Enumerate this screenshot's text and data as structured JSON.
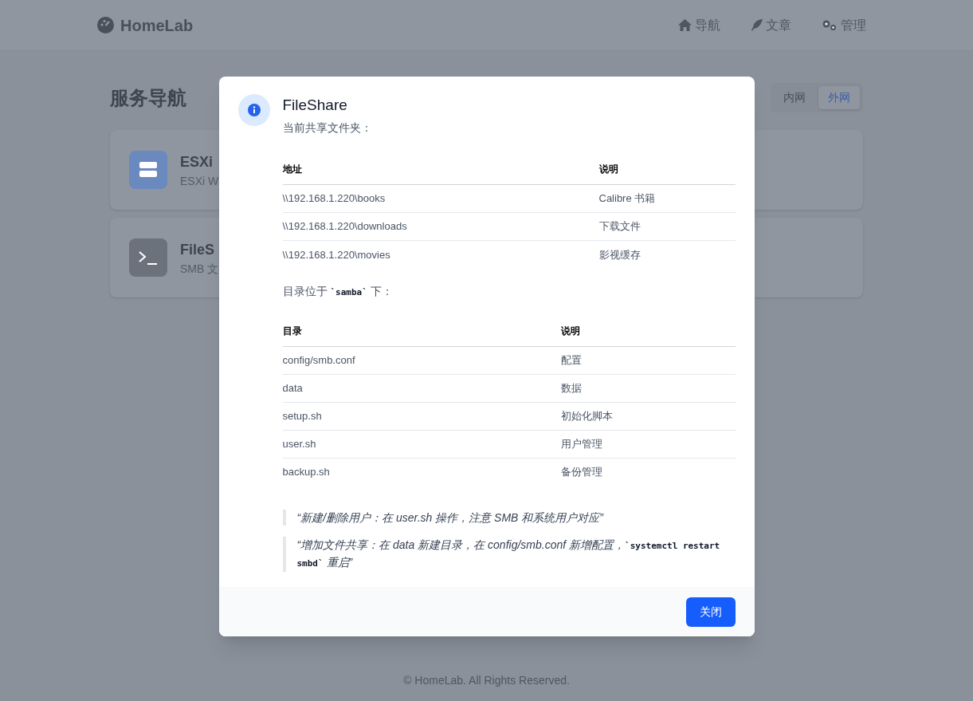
{
  "navbar": {
    "brand": "HomeLab",
    "links": [
      {
        "label": "导航",
        "kind": "home"
      },
      {
        "label": "文章",
        "kind": "feather"
      },
      {
        "label": "管理",
        "kind": "gears"
      }
    ]
  },
  "page": {
    "title": "服务导航",
    "tabs": [
      {
        "label": "内网",
        "selected": false
      },
      {
        "label": "外网",
        "selected": true
      }
    ],
    "cards": [
      {
        "title": "ESXi",
        "subtitle": "ESXi W",
        "kind": "server",
        "color": "#6a89bf"
      },
      {
        "title": "FileS",
        "subtitle": "SMB 文",
        "kind": "terminal",
        "color": "#6c727c"
      }
    ]
  },
  "footer": "© HomeLab. All Rights Reserved.",
  "dialog": {
    "title": "FileShare",
    "intro": [
      {
        "kind": "text",
        "text": "当前共享文件夹："
      }
    ],
    "table_1": {
      "columns": [
        "地址",
        "说明"
      ],
      "rows": [
        [
          "\\\\192.168.1.220\\books",
          "Calibre 书籍"
        ],
        [
          "\\\\192.168.1.220\\downloads",
          "下载文件"
        ],
        [
          "\\\\192.168.1.220\\movies",
          "影视缓存"
        ]
      ]
    },
    "note": [
      {
        "kind": "text",
        "text": "目录位于 "
      },
      {
        "kind": "code",
        "text": "`samba`"
      },
      {
        "kind": "text",
        "text": " 下："
      }
    ],
    "table_2": {
      "columns": [
        "目录",
        "说明"
      ],
      "rows": [
        [
          "config/smb.conf",
          "配置"
        ],
        [
          "data",
          "数据"
        ],
        [
          "setup.sh",
          "初始化脚本"
        ],
        [
          "user.sh",
          "用户管理"
        ],
        [
          "backup.sh",
          "备份管理"
        ]
      ]
    },
    "quotes": [
      [
        {
          "kind": "text",
          "text": "“新建/删除用户：在 user.sh 操作，注意 SMB 和系统用户对应”"
        }
      ],
      [
        {
          "kind": "text",
          "text": "“增加文件共享：在 data 新建目录，在 config/smb.conf 新增配置，"
        },
        {
          "kind": "code",
          "text": "`systemctl restart smbd`"
        },
        {
          "kind": "text",
          "text": " 重启”"
        }
      ]
    ],
    "button": "关闭"
  }
}
